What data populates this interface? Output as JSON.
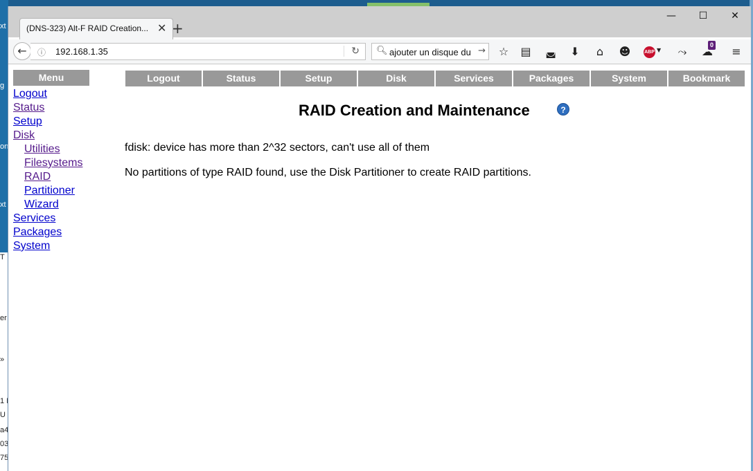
{
  "desktop_fragments": [
    "xt",
    "g",
    "on",
    "xt",
    "T",
    "er",
    "»",
    "1 I",
    "U",
    "a4",
    "03",
    "75"
  ],
  "browser": {
    "tab_title": "(DNS-323) Alt-F RAID Creation...",
    "url": "192.168.1.35",
    "search_value": "ajouter un disque du",
    "notification_count": "0",
    "adblock_label": "ABP"
  },
  "sidebar": {
    "heading": "Menu",
    "items": [
      {
        "label": "Logout"
      },
      {
        "label": "Status"
      },
      {
        "label": "Setup"
      },
      {
        "label": "Disk"
      },
      {
        "label": "Utilities"
      },
      {
        "label": "Filesystems"
      },
      {
        "label": "RAID"
      },
      {
        "label": "Partitioner"
      },
      {
        "label": "Wizard"
      },
      {
        "label": "Services"
      },
      {
        "label": "Packages"
      },
      {
        "label": "System"
      }
    ]
  },
  "topnav": [
    "Logout",
    "Status",
    "Setup",
    "Disk",
    "Services",
    "Packages",
    "System",
    "Bookmark"
  ],
  "main": {
    "title": "RAID Creation and Maintenance",
    "help_icon": "?",
    "messages": [
      "fdisk: device has more than 2^32 sectors, can't use all of them",
      "No partitions of type RAID found, use the Disk Partitioner to create RAID partitions."
    ]
  },
  "colors": {
    "nav_button_bg": "#999999",
    "link": "#0000cc",
    "visited_link": "#551a8b"
  }
}
